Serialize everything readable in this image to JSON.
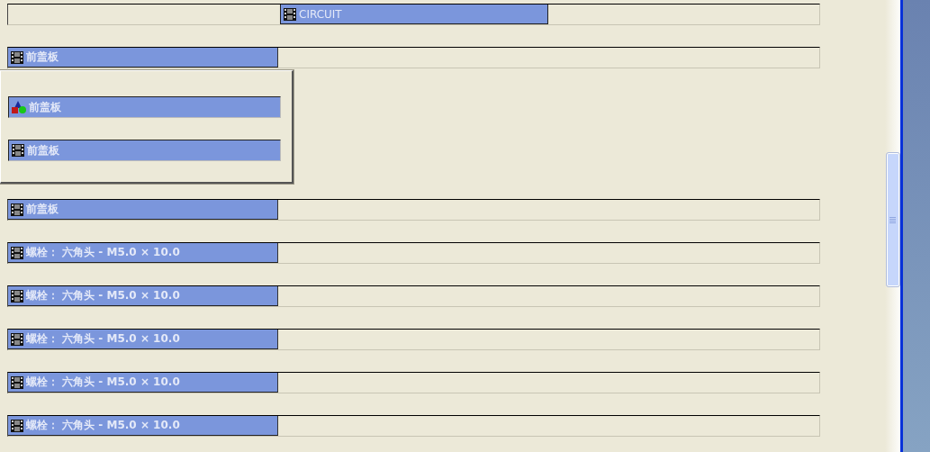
{
  "tree": {
    "label": "CIRCUIT",
    "kind": "part",
    "children": [
      {
        "label": "前盖板",
        "kind": "part",
        "children": [
          {
            "label": "前盖板",
            "kind": "assembly"
          },
          {
            "label": "前盖板",
            "kind": "part"
          }
        ]
      },
      {
        "label": "前盖板",
        "kind": "part"
      },
      {
        "label": "螺栓： 六角头 - M5.0 × 10.0",
        "kind": "part"
      },
      {
        "label": "螺栓： 六角头 - M5.0 × 10.0",
        "kind": "part"
      },
      {
        "label": "螺栓： 六角头 - M5.0 × 10.0",
        "kind": "part"
      },
      {
        "label": "螺栓： 六角头 - M5.0 × 10.0",
        "kind": "part"
      },
      {
        "label": "螺栓： 六角头 - M5.0 × 10.0",
        "kind": "part"
      }
    ]
  }
}
